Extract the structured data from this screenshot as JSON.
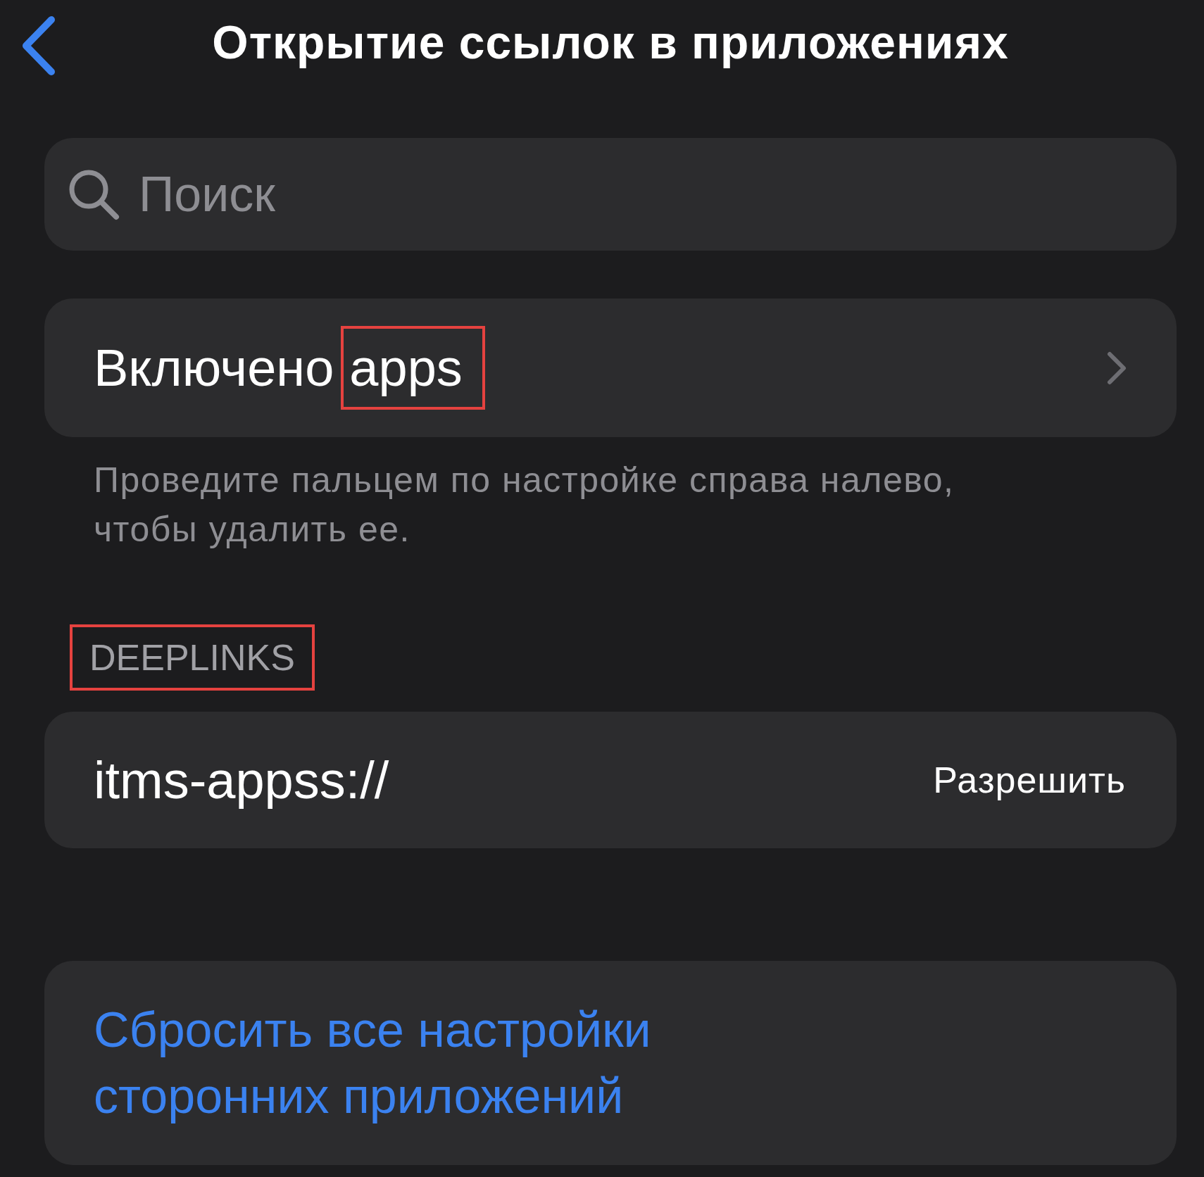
{
  "nav": {
    "title": "Открытие ссылок в приложениях"
  },
  "search": {
    "placeholder": "Поиск"
  },
  "enabled_row": {
    "label": "Включено",
    "value": "apps",
    "value_highlighted": true
  },
  "footer_note": "Проведите пальцем по настройке справа налево, чтобы удалить ее.",
  "section": {
    "header": "DEEPLINKS",
    "header_highlighted": true,
    "rows": [
      {
        "scheme": "itms-appss://",
        "action": "Разрешить"
      }
    ]
  },
  "reset_button": "Сбросить все настройки сторонних приложений"
}
